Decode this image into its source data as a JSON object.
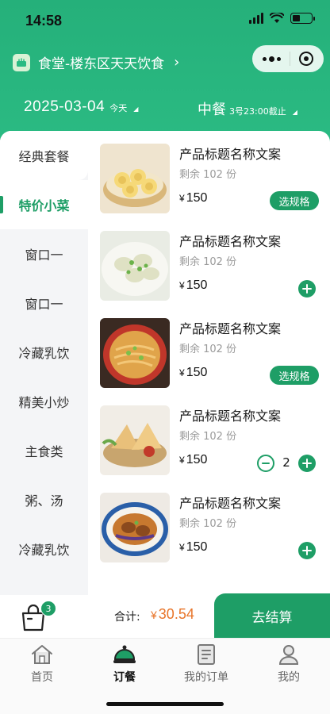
{
  "status_bar": {
    "time": "14:58"
  },
  "header": {
    "store_name": "食堂-楼东区天天饮食",
    "date": "2025-03-04",
    "date_note": "今天",
    "meal": "中餐",
    "deadline": "3号23:00截止"
  },
  "categories": [
    {
      "label": "经典套餐",
      "active": false
    },
    {
      "label": "特价小菜",
      "active": true
    },
    {
      "label": "窗口一",
      "active": false
    },
    {
      "label": "窗口一",
      "active": false
    },
    {
      "label": "冷藏乳饮",
      "active": false
    },
    {
      "label": "精美小炒",
      "active": false
    },
    {
      "label": "主食类",
      "active": false
    },
    {
      "label": "粥、汤",
      "active": false
    },
    {
      "label": "冷藏乳饮",
      "active": false
    }
  ],
  "products": [
    {
      "title": "产品标题名称文案",
      "stock": "剩余 102 份",
      "currency": "¥",
      "price": "150",
      "action": "spec",
      "spec_label": "选规格",
      "image": "steamed-buns"
    },
    {
      "title": "产品标题名称文案",
      "stock": "剩余 102 份",
      "currency": "¥",
      "price": "150",
      "action": "add",
      "image": "dumplings"
    },
    {
      "title": "产品标题名称文案",
      "stock": "剩余 102 份",
      "currency": "¥",
      "price": "150",
      "action": "spec",
      "spec_label": "选规格",
      "image": "spicy-noodles"
    },
    {
      "title": "产品标题名称文案",
      "stock": "剩余 102 份",
      "currency": "¥",
      "price": "150",
      "action": "stepper",
      "quantity": "2",
      "image": "samosas"
    },
    {
      "title": "产品标题名称文案",
      "stock": "剩余 102 份",
      "currency": "¥",
      "price": "150",
      "action": "add",
      "image": "stewed-dish"
    }
  ],
  "cart": {
    "badge_count": "3",
    "total_label": "合计:",
    "currency": "¥",
    "total_amount": "30.54",
    "checkout_label": "去结算"
  },
  "tabs": [
    {
      "label": "首页",
      "icon": "home-icon",
      "active": false
    },
    {
      "label": "订餐",
      "icon": "dish-cover-icon",
      "active": true
    },
    {
      "label": "我的订单",
      "icon": "order-list-icon",
      "active": false
    },
    {
      "label": "我的",
      "icon": "user-icon",
      "active": false
    }
  ],
  "colors": {
    "brand_green": "#1e9e66",
    "header_green": "#25b07a",
    "price_orange": "#e8752a"
  }
}
